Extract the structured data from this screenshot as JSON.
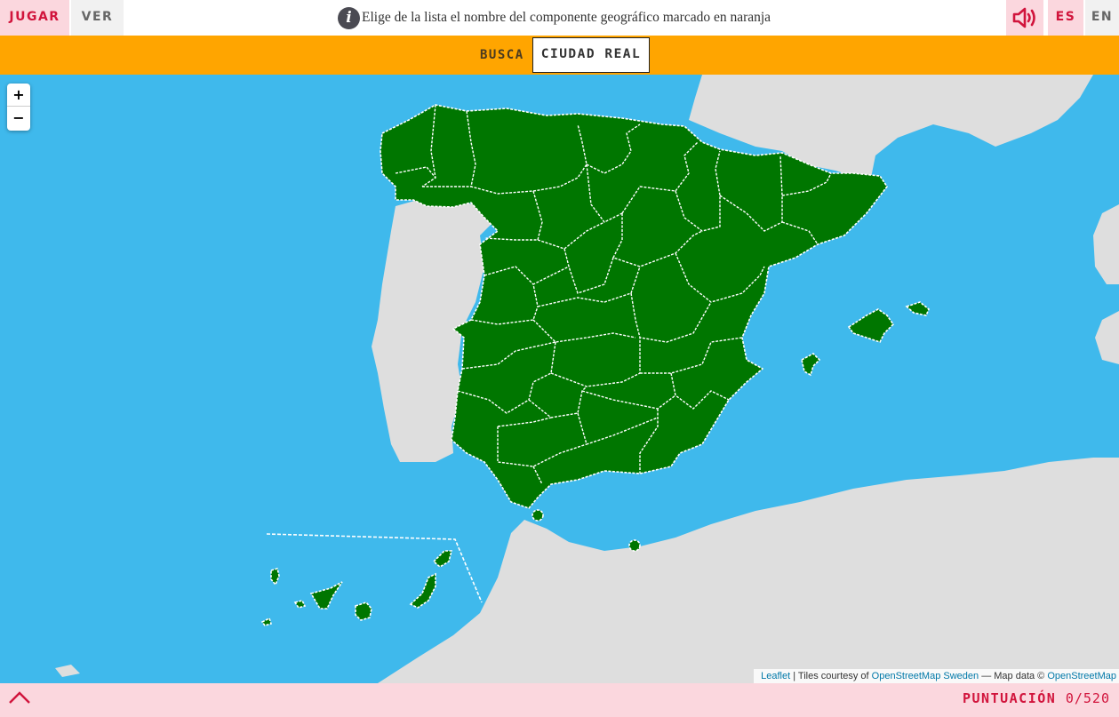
{
  "header": {
    "tabs": [
      {
        "label": "JUGAR",
        "active": true
      },
      {
        "label": "VER",
        "active": false
      }
    ],
    "instruction": "Elige de la lista el nombre del componente geográfico marcado en naranja",
    "info_icon": "info-icon",
    "sound_icon": "speaker-icon",
    "languages": [
      {
        "label": "ES",
        "active": true
      },
      {
        "label": "EN",
        "active": false
      }
    ]
  },
  "search": {
    "prompt_label": "BUSCA",
    "target_name": "CIUDAD REAL"
  },
  "map": {
    "zoom_in_label": "+",
    "zoom_out_label": "−",
    "attribution": {
      "leaflet": "Leaflet",
      "sep1": " | Tiles courtesy of ",
      "osm_sweden": "OpenStreetMap Sweden",
      "sep2": " — Map data © ",
      "osm": "OpenStreetMap"
    },
    "colors": {
      "sea": "#3fb9ec",
      "land": "#dedede",
      "province_fill": "#007600",
      "province_border": "#ffffff"
    }
  },
  "footer": {
    "toggle_icon": "chevron-up-icon",
    "score_label": "PUNTUACIÓN",
    "score_value": "0/520"
  },
  "colors": {
    "accent_red": "#d1143c",
    "accent_pink": "#fbd7de",
    "search_bar_orange": "#ffa500"
  }
}
